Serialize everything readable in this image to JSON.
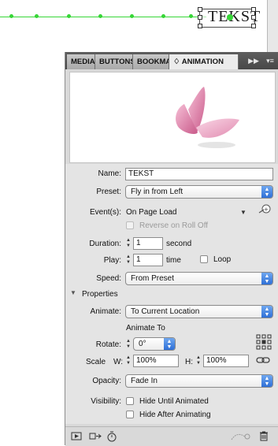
{
  "canvas": {
    "element_text": "TEKST"
  },
  "tabs": [
    {
      "label": "MEDIA"
    },
    {
      "label": "BUTTONS"
    },
    {
      "label": "BOOKMA"
    },
    {
      "label": "♢ ANIMATION"
    }
  ],
  "tabbar": {
    "forward_icon": "fast-forward-icon",
    "menu_icon": "panel-menu-icon"
  },
  "colors": {
    "accent": "#2e6fd6",
    "motion_path": "#37d637",
    "butterfly": "#e18ab0"
  },
  "form": {
    "name_label": "Name:",
    "name_value": "TEKST",
    "preset_label": "Preset:",
    "preset_value": "Fly in from Left",
    "events_label": "Event(s):",
    "events_value": "On Page Load",
    "reverse_label": "Reverse on Roll Off",
    "duration_label": "Duration:",
    "duration_value": "1",
    "duration_unit": "second",
    "play_label": "Play:",
    "play_value": "1",
    "play_unit": "time",
    "loop_label": "Loop",
    "speed_label": "Speed:",
    "speed_value": "From Preset",
    "properties_label": "Properties",
    "animate_label": "Animate:",
    "animate_value": "To Current Location",
    "animate_to_label": "Animate To",
    "rotate_label": "Rotate:",
    "rotate_value": "0°",
    "scale_label": "Scale",
    "w_label": "W:",
    "w_value": "100%",
    "h_label": "H:",
    "h_value": "100%",
    "opacity_label": "Opacity:",
    "opacity_value": "Fade In",
    "visibility_label": "Visibility:",
    "hide_until_label": "Hide Until Animated",
    "hide_after_label": "Hide After Animating"
  }
}
